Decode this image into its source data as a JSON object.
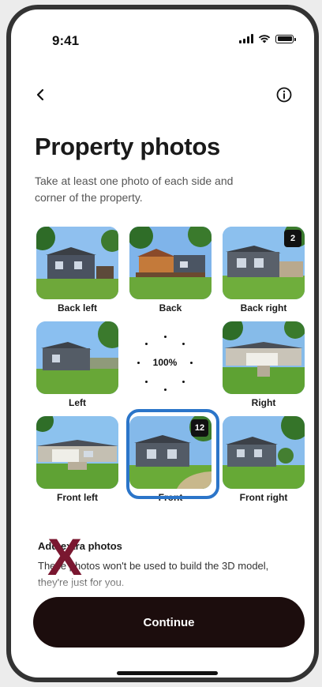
{
  "status_bar": {
    "time": "9:41"
  },
  "header": {
    "back_icon": "chevron-left-icon",
    "info_icon": "info-circle-icon",
    "title": "Property photos",
    "subtitle": "Take at least one photo of each side and corner of the property."
  },
  "photos": [
    {
      "label": "Back left",
      "count": ""
    },
    {
      "label": "Back",
      "count": ""
    },
    {
      "label": "Back right",
      "count": "2"
    },
    {
      "label": "Left",
      "count": ""
    },
    {
      "label": "Right",
      "count": ""
    },
    {
      "label": "Front left",
      "count": ""
    },
    {
      "label": "Front",
      "count": "12",
      "selected": true
    },
    {
      "label": "Front right",
      "count": ""
    }
  ],
  "progress": {
    "text": "100%",
    "value": 100
  },
  "extra": {
    "title": "Add extra photos",
    "text": "These photos won't be used to build the 3D model, they're just for you."
  },
  "overlay_mark": "X",
  "continue_label": "Continue",
  "colors": {
    "button": "#1c0d0d",
    "selection": "#2b75c9",
    "overlay_mark": "#7a1730"
  }
}
